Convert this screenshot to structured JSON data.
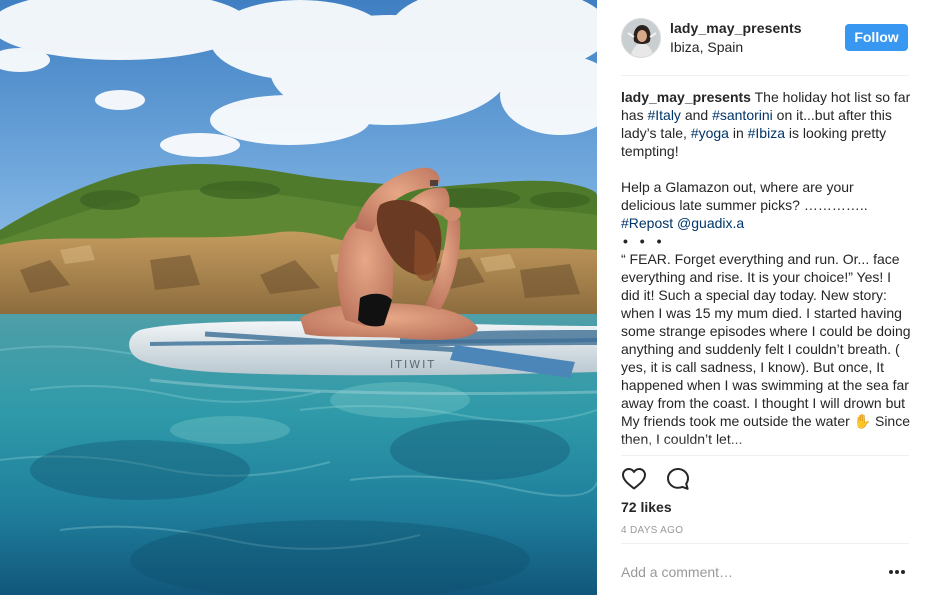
{
  "post": {
    "username": "lady_may_presents",
    "location": "Ibiza, Spain",
    "follow_label": "Follow",
    "photo_watermark": "ITIWIT"
  },
  "caption": {
    "username": "lady_may_presents",
    "line1_a": " The holiday hot list so far has ",
    "tag_italy": "#Italy",
    "line1_b": " and ",
    "tag_santorini": "#santorini",
    "line1_c": " on it...but after this lady’s tale, ",
    "tag_yoga": "#yoga",
    "line1_d": " in ",
    "tag_ibiza": "#Ibiza",
    "line1_e": " is looking pretty tempting!",
    "para2": "Help a Glamazon out, where are your delicious late summer picks? …………..",
    "tag_repost": "#Repost",
    "mention_guadix": "@guadix.a",
    "dots": "• • •",
    "para3": "“ FEAR. Forget everything and run. Or... face everything and rise. It is your choice!” Yes! I did it! Such a special day today. New story: when I was 15 my mum died. I started having some strange episodes where I could be doing anything and suddenly felt I couldn’t breath. ( yes, it is call sadness, I know). But once, It happened when I was swimming at the sea far away from the coast. I thought I will drown but My friends took me outside the water ✋ Since then, I couldn’t let..."
  },
  "actions": {
    "like_icon": "heart-icon",
    "comment_icon": "comment-icon"
  },
  "likes_text": "72 likes",
  "timestamp": "4 DAYS AGO",
  "comment": {
    "placeholder": "Add a comment…",
    "more_icon": "more-options-icon"
  },
  "colors": {
    "follow_bg": "#3897f0",
    "hashtag": "#003569",
    "muted": "#999999",
    "divider": "#efefef"
  }
}
